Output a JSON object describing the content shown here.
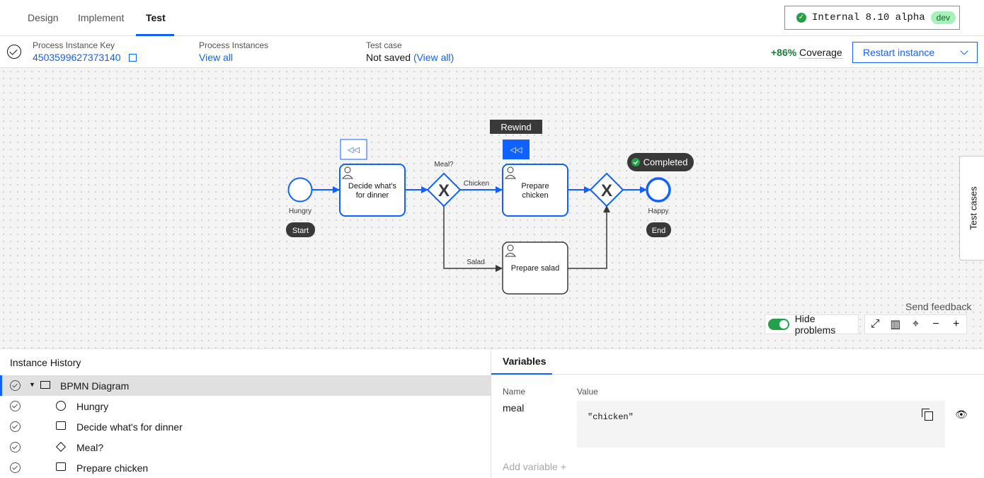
{
  "nav": {
    "tabs": [
      "Design",
      "Implement",
      "Test"
    ],
    "active_tab": "Test",
    "environment": {
      "label": "Internal 8.10 alpha",
      "tag": "dev"
    }
  },
  "info": {
    "process_key_label": "Process Instance Key",
    "process_key_value": "4503599627373140",
    "instances_label": "Process Instances",
    "instances_link": "View all",
    "testcase_label": "Test case",
    "testcase_value": "Not saved",
    "testcase_link": "(View all)",
    "coverage_pct": "+86%",
    "coverage_label": "Coverage",
    "restart_label": "Restart instance"
  },
  "diagram": {
    "rewind_label": "Rewind",
    "completed_label": "Completed",
    "start_event_label": "Hungry",
    "start_badge": "Start",
    "end_event_label": "Happy",
    "end_badge": "End",
    "task_decide_line1": "Decide what's",
    "task_decide_line2": "for dinner",
    "gateway_label": "Meal?",
    "flow_chicken": "Chicken",
    "flow_salad": "Salad",
    "task_chicken_line1": "Prepare",
    "task_chicken_line2": "chicken",
    "task_salad": "Prepare salad",
    "test_cases_tab": "Test cases",
    "send_feedback": "Send feedback",
    "hide_problems": "Hide problems"
  },
  "history": {
    "title": "Instance History",
    "rows": [
      {
        "label": "BPMN Diagram",
        "icon": "diagram-icon"
      },
      {
        "label": "Hungry",
        "icon": "circle-icon"
      },
      {
        "label": "Decide what's for dinner",
        "icon": "task-icon"
      },
      {
        "label": "Meal?",
        "icon": "gateway-icon"
      },
      {
        "label": "Prepare chicken",
        "icon": "task-icon"
      }
    ]
  },
  "variables": {
    "tab": "Variables",
    "col_name": "Name",
    "col_value": "Value",
    "items": [
      {
        "name": "meal",
        "value": "\"chicken\""
      }
    ],
    "add_label": "Add variable  +"
  },
  "colors": {
    "accent": "#0f62fe",
    "success": "#24a148",
    "dark": "#393939"
  }
}
